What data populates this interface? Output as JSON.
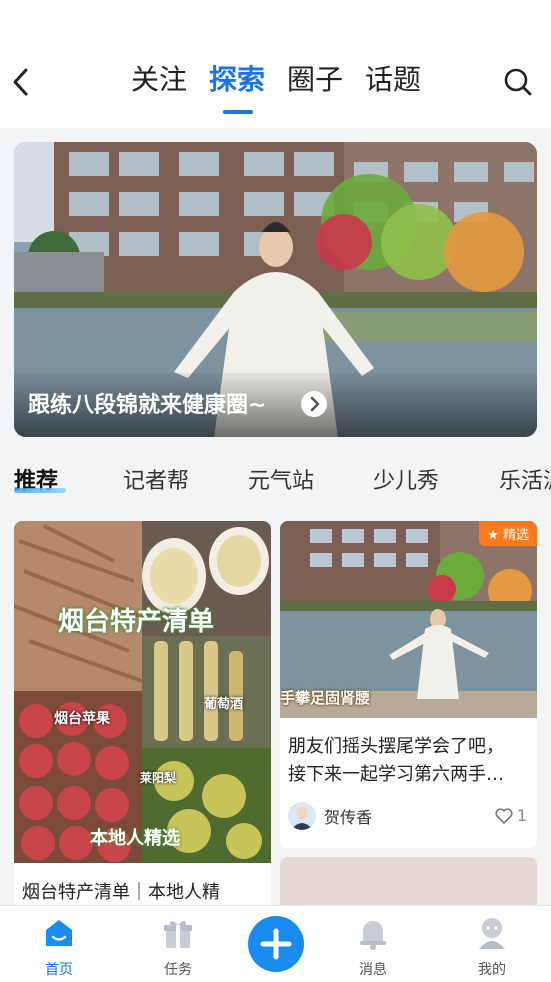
{
  "header": {
    "tabs": [
      {
        "label": "关注",
        "active": false
      },
      {
        "label": "探索",
        "active": true
      },
      {
        "label": "圈子",
        "active": false
      },
      {
        "label": "话题",
        "active": false
      }
    ]
  },
  "banner": {
    "title": "跟练八段锦就来健康圈~"
  },
  "categories": [
    {
      "label": "推荐",
      "active": true
    },
    {
      "label": "记者帮",
      "active": false
    },
    {
      "label": "元气站",
      "active": false
    },
    {
      "label": "少儿秀",
      "active": false
    },
    {
      "label": "乐活派",
      "active": false
    }
  ],
  "feed": {
    "left_card": {
      "image_text": "烟台特产清单",
      "sticker_1": "烟台苹果",
      "sticker_2": "葡萄酒",
      "sticker_3": "莱阳梨",
      "sticker_4": "本地人精选",
      "title": "烟台特产清单｜本地人精"
    },
    "right_card": {
      "badge": "精选",
      "image_caption": "手攀足固肾腰",
      "title_line1": "朋友们摇头摆尾学会了吧，",
      "title_line2": "接下来一起学习第六两手…",
      "author": "贺传香",
      "likes": "1"
    }
  },
  "bottom_nav": [
    {
      "label": "首页",
      "icon": "home-icon",
      "active": true
    },
    {
      "label": "任务",
      "icon": "gift-icon",
      "active": false
    },
    {
      "label": "",
      "icon": "plus-icon",
      "active": false
    },
    {
      "label": "消息",
      "icon": "bell-icon",
      "active": false
    },
    {
      "label": "我的",
      "icon": "profile-icon",
      "active": false
    }
  ],
  "colors": {
    "accent": "#1a73e8",
    "badge": "#ff7a1a"
  }
}
